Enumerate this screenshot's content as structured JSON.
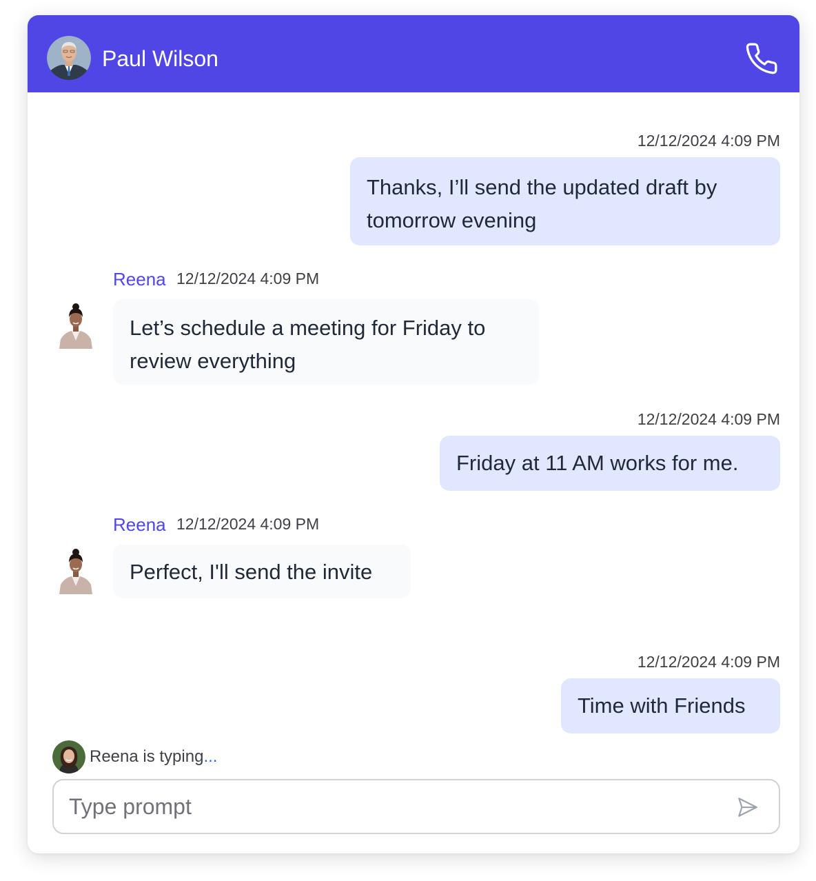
{
  "header": {
    "name": "Paul Wilson",
    "avatar_icon": "man-avatar",
    "call_icon": "phone-icon",
    "background": "#4f46e5"
  },
  "messages": [
    {
      "direction": "outgoing",
      "timestamp": "12/12/2024 4:09 PM",
      "lines": [
        "Thanks, I’ll send the updated draft by",
        "tomorrow evening"
      ]
    },
    {
      "direction": "incoming",
      "sender": "Reena",
      "timestamp": "12/12/2024 4:09 PM",
      "lines": [
        "Let’s schedule a meeting for Friday to",
        "review everything"
      ]
    },
    {
      "direction": "outgoing",
      "timestamp": "12/12/2024 4:09 PM",
      "lines": [
        "Friday at 11 AM works for me."
      ]
    },
    {
      "direction": "incoming",
      "sender": "Reena",
      "timestamp": "12/12/2024 4:09 PM",
      "lines": [
        "Perfect, I'll send the invite"
      ]
    },
    {
      "direction": "outgoing",
      "timestamp": "12/12/2024 4:09 PM",
      "lines": [
        "Time with Friends"
      ]
    }
  ],
  "typing": {
    "text": "Reena is typing",
    "dots": "..."
  },
  "composer": {
    "placeholder": "Type prompt",
    "value": "",
    "send_icon": "send-icon"
  },
  "colors": {
    "accent": "#4f46e5",
    "outgoing_bubble": "#e0e7ff",
    "incoming_bubble": "#f9fafb"
  }
}
